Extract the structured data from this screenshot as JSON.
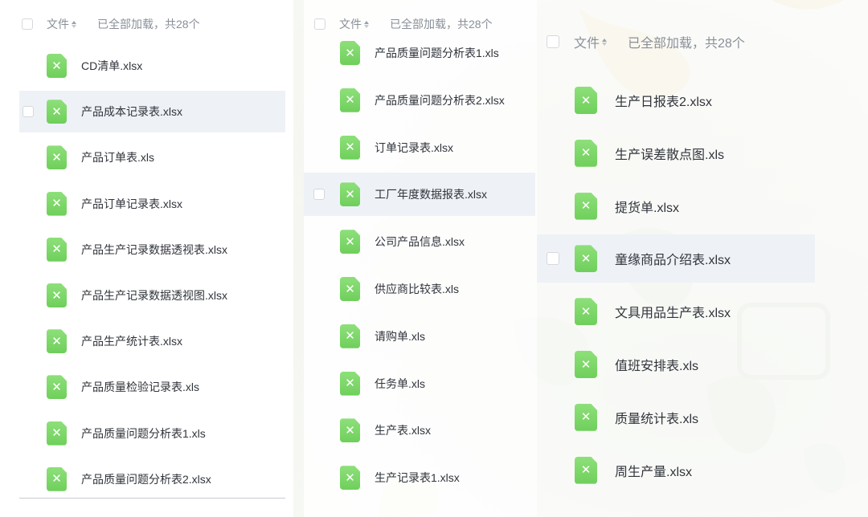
{
  "panel1": {
    "header": {
      "file_label": "文件",
      "status": "已全部加载，共28个"
    },
    "files": [
      "CD清单.xlsx",
      "产品成本记录表.xlsx",
      "产品订单表.xls",
      "产品订单记录表.xlsx",
      "产品生产记录数据透视表.xlsx",
      "产品生产记录数据透视图.xlsx",
      "产品生产统计表.xlsx",
      "产品质量检验记录表.xls",
      "产品质量问题分析表1.xls",
      "产品质量问题分析表2.xlsx"
    ],
    "highlighted_index": 1
  },
  "panel2": {
    "header": {
      "file_label": "文件",
      "status": "已全部加载，共28个"
    },
    "files": [
      "产品质量问题分析表1.xls",
      "产品质量问题分析表2.xlsx",
      "订单记录表.xlsx",
      "工厂年度数据报表.xlsx",
      "公司产品信息.xlsx",
      "供应商比较表.xls",
      "请购单.xls",
      "任务单.xls",
      "生产表.xlsx",
      "生产记录表1.xlsx"
    ],
    "highlighted_index": 3
  },
  "panel3": {
    "header": {
      "file_label": "文件",
      "status": "已全部加载，共28个"
    },
    "files": [
      "生产日报表2.xlsx",
      "生产误差散点图.xls",
      "提货单.xlsx",
      "童缘商品介绍表.xlsx",
      "文具用品生产表.xlsx",
      "值班安排表.xls",
      "质量统计表.xls",
      "周生产量.xlsx"
    ],
    "highlighted_index": 3
  },
  "icons": {
    "file_icon": "excel-file-icon",
    "file_icon_glyph": "✕",
    "file_icon_color": "#7bd866",
    "sort_icon": "sort-icon"
  }
}
